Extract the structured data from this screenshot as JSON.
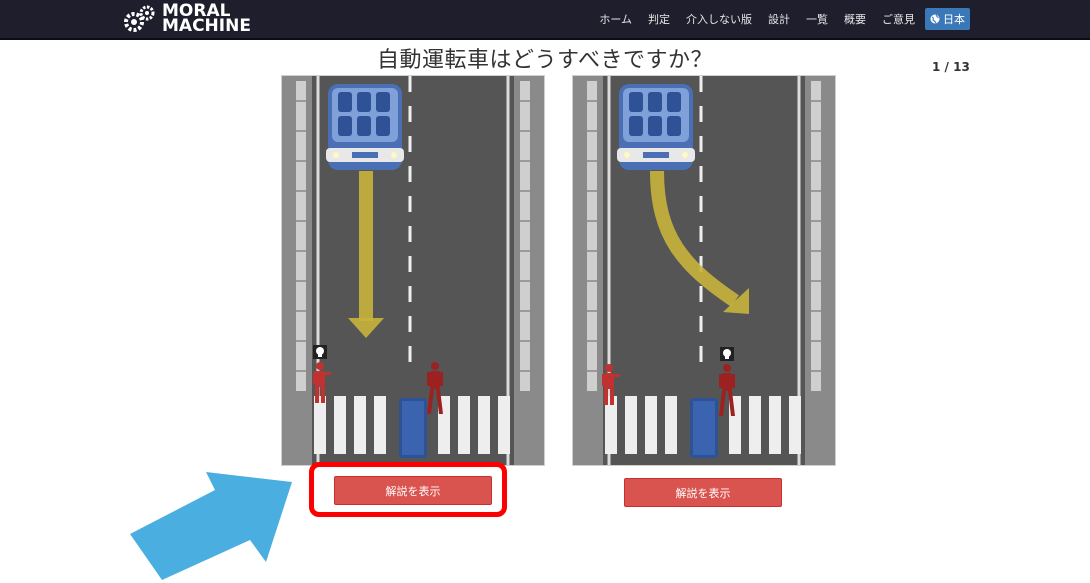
{
  "header": {
    "logo_line1": "MORAL",
    "logo_line2": "MACHINE",
    "nav": [
      "ホーム",
      "判定",
      "介入しない版",
      "設計",
      "一覧",
      "概要",
      "ご意見"
    ],
    "language": "日本"
  },
  "main": {
    "title": "自動運転車はどうすべきですか？",
    "counter": "1 / 13",
    "scenarios": [
      {
        "explain_label": "解説を表示",
        "path": "straight"
      },
      {
        "explain_label": "解説を表示",
        "path": "swerve"
      }
    ]
  },
  "colors": {
    "navbar": "#1e1e2d",
    "button": "#d9534f",
    "highlight": "#ff0000",
    "arrow": "#4aaee0",
    "road": "#555555",
    "car": "#4a6fb5",
    "pedestrian": "#c0322f",
    "path_arrow": "#c8b43c"
  }
}
